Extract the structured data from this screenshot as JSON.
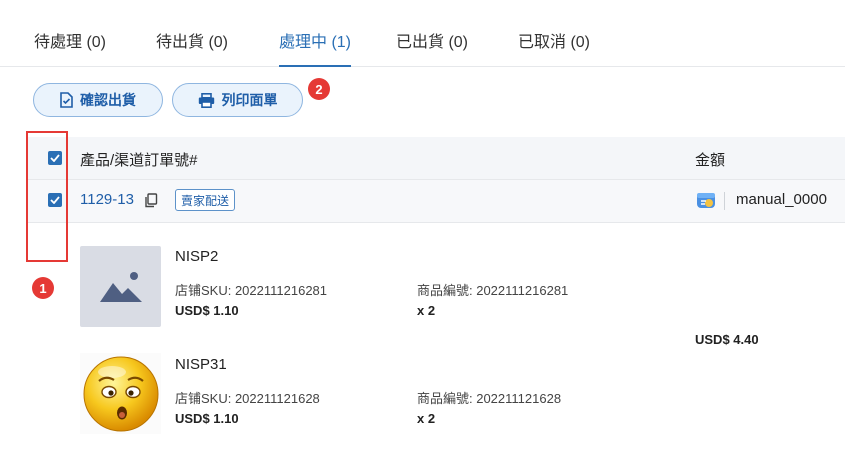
{
  "tabs": [
    {
      "label": "待處理 (0)",
      "active": false
    },
    {
      "label": "待出貨 (0)",
      "active": false
    },
    {
      "label": "處理中 (1)",
      "active": true
    },
    {
      "label": "已出貨 (0)",
      "active": false
    },
    {
      "label": "已取消 (0)",
      "active": false
    }
  ],
  "actions": {
    "confirm_label": "確認出貨",
    "print_label": "列印面單"
  },
  "annotations": {
    "badge_1": "1",
    "badge_2": "2"
  },
  "table": {
    "header": {
      "product_col": "產品/渠道訂單號#",
      "amount_col": "金額"
    },
    "order": {
      "order_no": "1129-13",
      "tag": "賣家配送",
      "store": "manual_0000"
    },
    "amount": "USD$ 4.40",
    "items": [
      {
        "name": "NISP2",
        "sku": "店铺SKU: 2022111216281",
        "code": "商品編號: 2022111216281",
        "price": "USD$ 1.10",
        "qty": "x 2",
        "thumb": "image-placeholder-icon"
      },
      {
        "name": "NISP31",
        "sku": "店铺SKU: 202211121628",
        "code": "商品編號: 202211121628",
        "price": "USD$ 1.10",
        "qty": "x 2",
        "thumb": "worried-emoji-icon"
      }
    ]
  },
  "colors": {
    "accent": "#2a6fb5",
    "annotation": "#e53935"
  }
}
